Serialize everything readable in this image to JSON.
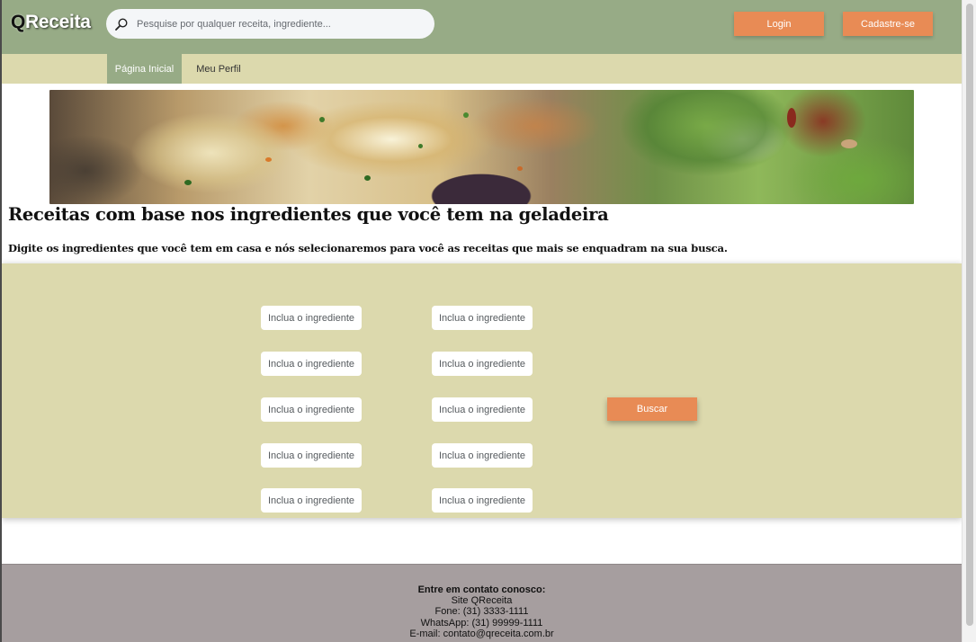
{
  "brand": {
    "logo_q": "Q",
    "logo_rest": "Receita"
  },
  "search": {
    "placeholder": "Pesquise por qualquer receita, ingrediente...",
    "icon": "search-icon"
  },
  "header": {
    "login_label": "Login",
    "signup_label": "Cadastre-se"
  },
  "nav": {
    "items": [
      {
        "label": "Página Inicial",
        "active": true
      },
      {
        "label": "Meu Perfil",
        "active": false
      }
    ]
  },
  "main": {
    "title": "Receitas com base nos ingredientes que você tem na geladeira",
    "subtitle": "Digite os ingredientes que você tem em casa e nós selecionaremos para você as receitas que mais se enquadram na sua busca."
  },
  "ingredients": {
    "placeholder": "Inclua o ingrediente",
    "count": 10,
    "search_label": "Buscar"
  },
  "footer": {
    "title": "Entre em contato conosco:",
    "lines": [
      "Site QReceita",
      "Fone: (31) 3333-1111",
      "WhatsApp: (31) 99999-1111",
      "E-mail: contato@qreceita.com.br"
    ]
  },
  "colors": {
    "header": "#97ab86",
    "nav": "#dcd9ad",
    "accent": "#e88b55",
    "footer": "#a69e9f"
  }
}
